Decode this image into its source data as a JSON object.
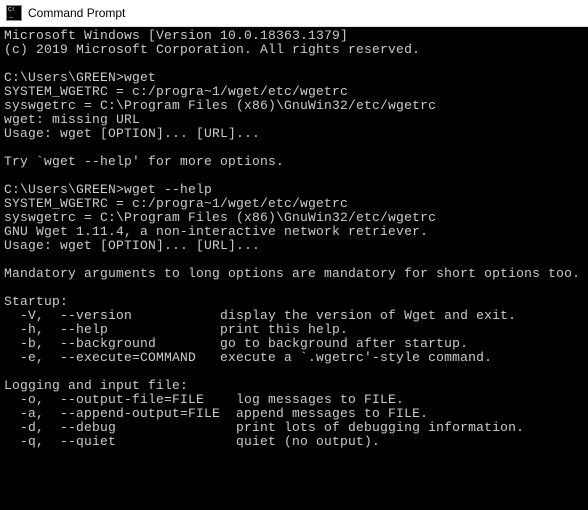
{
  "window": {
    "title": "Command Prompt"
  },
  "terminal": {
    "lines": [
      "Microsoft Windows [Version 10.0.18363.1379]",
      "(c) 2019 Microsoft Corporation. All rights reserved.",
      "",
      "C:\\Users\\GREEN>wget",
      "SYSTEM_WGETRC = c:/progra~1/wget/etc/wgetrc",
      "syswgetrc = C:\\Program Files (x86)\\GnuWin32/etc/wgetrc",
      "wget: missing URL",
      "Usage: wget [OPTION]... [URL]...",
      "",
      "Try `wget --help' for more options.",
      "",
      "C:\\Users\\GREEN>wget --help",
      "SYSTEM_WGETRC = c:/progra~1/wget/etc/wgetrc",
      "syswgetrc = C:\\Program Files (x86)\\GnuWin32/etc/wgetrc",
      "GNU Wget 1.11.4, a non-interactive network retriever.",
      "Usage: wget [OPTION]... [URL]...",
      "",
      "Mandatory arguments to long options are mandatory for short options too.",
      "",
      "Startup:",
      "  -V,  --version           display the version of Wget and exit.",
      "  -h,  --help              print this help.",
      "  -b,  --background        go to background after startup.",
      "  -e,  --execute=COMMAND   execute a `.wgetrc'-style command.",
      "",
      "Logging and input file:",
      "  -o,  --output-file=FILE    log messages to FILE.",
      "  -a,  --append-output=FILE  append messages to FILE.",
      "  -d,  --debug               print lots of debugging information.",
      "  -q,  --quiet               quiet (no output)."
    ]
  }
}
